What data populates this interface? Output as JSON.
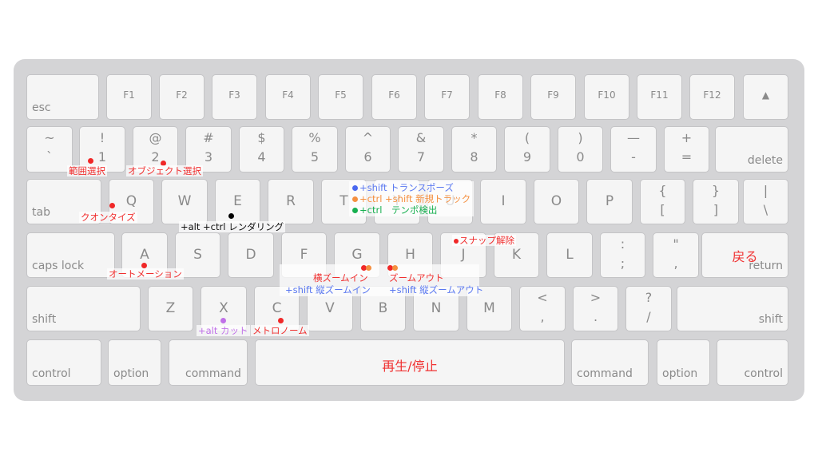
{
  "keyboard": {
    "row_function": [
      "esc",
      "F1",
      "F2",
      "F3",
      "F4",
      "F5",
      "F6",
      "F7",
      "F8",
      "F9",
      "F10",
      "F11",
      "F12",
      "▲"
    ],
    "row_number": [
      {
        "top": "~",
        "bottom": "`"
      },
      {
        "top": "!",
        "bottom": "1"
      },
      {
        "top": "@",
        "bottom": "2"
      },
      {
        "top": "#",
        "bottom": "3"
      },
      {
        "top": "$",
        "bottom": "4"
      },
      {
        "top": "%",
        "bottom": "5"
      },
      {
        "top": "^",
        "bottom": "6"
      },
      {
        "top": "&",
        "bottom": "7"
      },
      {
        "top": "*",
        "bottom": "8"
      },
      {
        "top": "(",
        "bottom": "9"
      },
      {
        "top": ")",
        "bottom": "0"
      },
      {
        "top": "—",
        "bottom": "-"
      },
      {
        "top": "+",
        "bottom": "="
      },
      {
        "label": "delete"
      }
    ],
    "row_tab": [
      {
        "label": "tab"
      },
      {
        "label": "Q"
      },
      {
        "label": "W"
      },
      {
        "label": "E"
      },
      {
        "label": "R"
      },
      {
        "label": "T"
      },
      {
        "label": "Y"
      },
      {
        "label": "U"
      },
      {
        "label": "I"
      },
      {
        "label": "O"
      },
      {
        "label": "P"
      },
      {
        "top": "{",
        "bottom": "["
      },
      {
        "top": "}",
        "bottom": "]"
      },
      {
        "top": "|",
        "bottom": "\\"
      }
    ],
    "row_caps": [
      {
        "label": "caps lock"
      },
      {
        "label": "A"
      },
      {
        "label": "S"
      },
      {
        "label": "D"
      },
      {
        "label": "F"
      },
      {
        "label": "G"
      },
      {
        "label": "H"
      },
      {
        "label": "J"
      },
      {
        "label": "K"
      },
      {
        "label": "L"
      },
      {
        "top": ":",
        "bottom": ";"
      },
      {
        "top": "\"",
        "bottom": ","
      },
      {
        "label": "return",
        "annotation": "戻る"
      }
    ],
    "row_shift": [
      {
        "label": "shift"
      },
      {
        "label": "Z"
      },
      {
        "label": "X"
      },
      {
        "label": "C"
      },
      {
        "label": "V"
      },
      {
        "label": "B"
      },
      {
        "label": "N"
      },
      {
        "label": "M"
      },
      {
        "top": "<",
        "bottom": ","
      },
      {
        "top": ">",
        "bottom": "."
      },
      {
        "top": "?",
        "bottom": "/"
      },
      {
        "label": "shift"
      }
    ],
    "row_bottom": [
      {
        "label": "control"
      },
      {
        "label": "option"
      },
      {
        "label": "command"
      },
      {
        "label": "",
        "annotation": "再生/停止"
      },
      {
        "label": "command"
      },
      {
        "label": "option"
      },
      {
        "label": "control"
      }
    ]
  },
  "annotations": {
    "range_select": "範囲選択",
    "object_select": "オブジェクト選択",
    "quantize": "クオンタイズ",
    "render": "+alt +ctrl レンダリング",
    "transpose": "+shift トランスポーズ",
    "new_track": "+ctrl +shift 新規トラック",
    "tempo_detect": "+ctrl　テンポ検出",
    "snap_off": "スナップ解除",
    "automation": "オートメーション",
    "h_zoom_in": "横ズームイン",
    "v_zoom_in": "+shift 縦ズームイン",
    "zoom_out": "ズームアウト",
    "v_zoom_out": "+shift 縦ズームアウト",
    "cut": "+alt カット",
    "metronome": "メトロノーム"
  },
  "colors": {
    "red": "#f03030",
    "blue": "#5a78f0",
    "orange": "#f59040",
    "green": "#18b050",
    "black": "#111111",
    "purple": "#c070e8"
  }
}
